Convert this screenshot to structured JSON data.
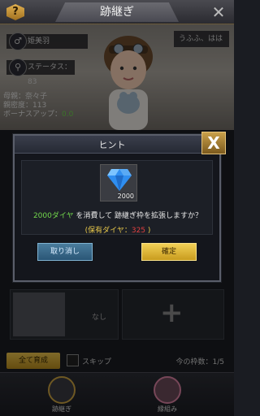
{
  "header": {
    "help_label": "?",
    "title": "跡継ぎ",
    "close_label": "✕"
  },
  "scene": {
    "name_label": "姫美羽",
    "status_label": "ステータス：83",
    "speech_text": "うふふ、はは",
    "mother_label": "母親：奈々子",
    "intimacy_label": "親密度：113",
    "bonus_prefix": "ボーナスアップ：",
    "bonus_value": "0.0"
  },
  "dialog": {
    "title": "ヒント",
    "close_label": "X",
    "gem_amount": "2000",
    "message_highlight": "2000ダイヤ",
    "message_rest": " を消費して 跡継ぎ枠を拡張しますか？",
    "owned_prefix": "(保有ダイヤ：",
    "owned_value": "325",
    "owned_suffix": " )",
    "cancel_label": "取り消し",
    "confirm_label": "確定"
  },
  "slots": {
    "empty_label": "なし",
    "add_label": "+"
  },
  "bottom": {
    "all_label": "全て育成",
    "skip_label": "スキップ",
    "slot_count_label": "今の枠数：1/5"
  },
  "nav": {
    "item1_label": "跡継ぎ",
    "item2_label": "縁組み"
  },
  "colors": {
    "accent_gold": "#e8c04c",
    "highlight_green": "#72d84c",
    "warning_red": "#e04040"
  }
}
